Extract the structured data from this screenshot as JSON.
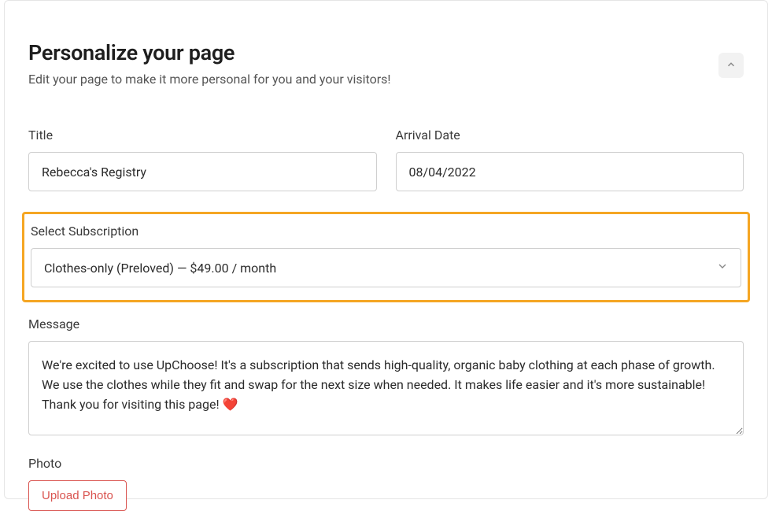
{
  "section": {
    "title": "Personalize your page",
    "subtitle": "Edit your page to make it more personal for you and your visitors!"
  },
  "fields": {
    "title": {
      "label": "Title",
      "value": "Rebecca's Registry"
    },
    "arrival_date": {
      "label": "Arrival Date",
      "value": "08/04/2022"
    },
    "subscription": {
      "label": "Select Subscription",
      "value": "Clothes-only (Preloved) — $49.00 / month"
    },
    "message": {
      "label": "Message",
      "value": "We're excited to use UpChoose! It's a subscription that sends high-quality, organic baby clothing at each phase of growth. We use the clothes while they fit and swap for the next size when needed. It makes life easier and it's more sustainable! Thank you for visiting this page! ❤️"
    },
    "photo": {
      "label": "Photo",
      "upload_label": "Upload Photo"
    }
  }
}
